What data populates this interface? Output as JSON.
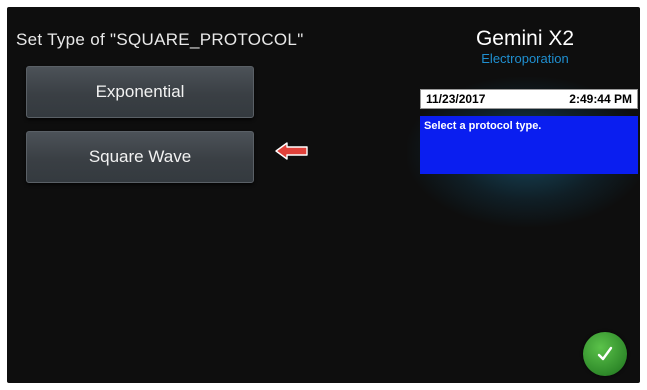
{
  "header": {
    "title": "Set Type of \"SQUARE_PROTOCOL\""
  },
  "options": [
    {
      "label": "Exponential"
    },
    {
      "label": "Square Wave"
    }
  ],
  "brand": {
    "name": "Gemini X2",
    "subtitle": "Electroporation"
  },
  "status": {
    "date": "11/23/2017",
    "time": "2:49:44 PM",
    "message": "Select a protocol type."
  },
  "icons": {
    "pointer": "arrow-left-icon",
    "confirm": "checkmark-icon"
  },
  "colors": {
    "background": "#0e0e0e",
    "button": "#3a3f44",
    "accent_blue": "#1f8fd0",
    "message_bg": "#0a1ef0",
    "arrow": "#e0413a",
    "confirm_green": "#2f8a2a"
  }
}
